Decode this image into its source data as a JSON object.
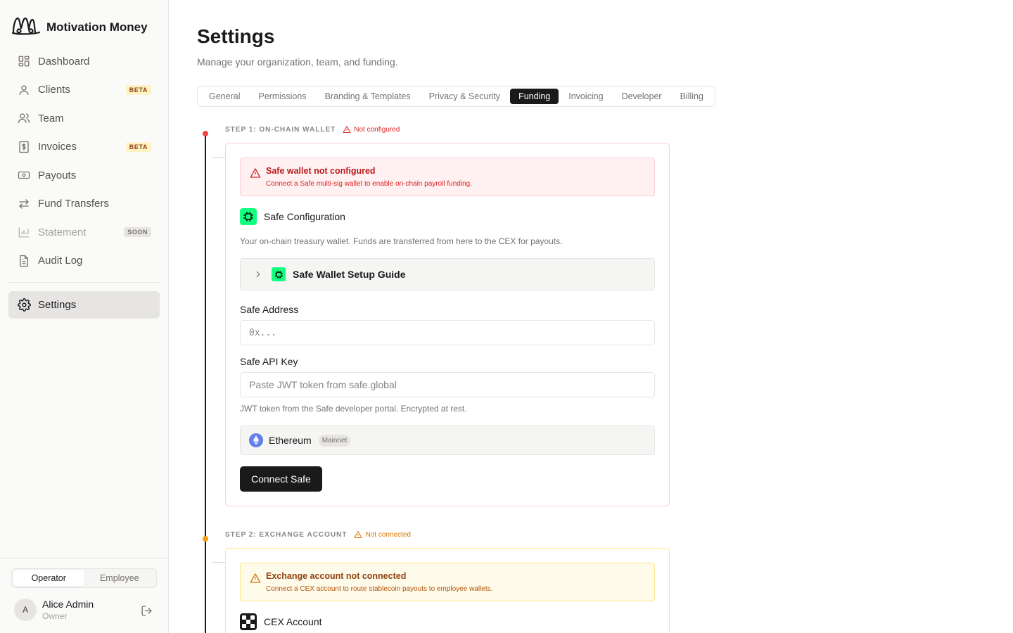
{
  "app": {
    "name": "Motivation Money"
  },
  "sidebar": {
    "items": [
      {
        "label": "Dashboard",
        "icon": "dashboard-icon"
      },
      {
        "label": "Clients",
        "icon": "user-icon",
        "badge": "BETA"
      },
      {
        "label": "Team",
        "icon": "users-icon"
      },
      {
        "label": "Invoices",
        "icon": "invoice-icon",
        "badge": "BETA"
      },
      {
        "label": "Payouts",
        "icon": "banknote-icon"
      },
      {
        "label": "Fund Transfers",
        "icon": "arrows-icon"
      },
      {
        "label": "Statement",
        "icon": "chart-icon",
        "badge": "SOON",
        "disabled": true
      },
      {
        "label": "Audit Log",
        "icon": "file-icon"
      }
    ],
    "settings": {
      "label": "Settings",
      "icon": "gear-icon"
    },
    "role_toggle": {
      "operator": "Operator",
      "employee": "Employee",
      "selected": "Operator"
    },
    "user": {
      "initial": "A",
      "name": "Alice Admin",
      "role": "Owner"
    }
  },
  "header": {
    "title": "Settings",
    "subtitle": "Manage your organization, team, and funding."
  },
  "tabs": [
    {
      "label": "General"
    },
    {
      "label": "Permissions"
    },
    {
      "label": "Branding & Templates"
    },
    {
      "label": "Privacy & Security"
    },
    {
      "label": "Funding",
      "active": true
    },
    {
      "label": "Invoicing"
    },
    {
      "label": "Developer"
    },
    {
      "label": "Billing"
    }
  ],
  "step1": {
    "label": "STEP 1: ON-CHAIN WALLET",
    "status": "Not configured",
    "alert_title": "Safe wallet not configured",
    "alert_desc": "Connect a Safe multi-sig wallet to enable on-chain payroll funding.",
    "section_title": "Safe Configuration",
    "description": "Your on-chain treasury wallet. Funds are transferred from here to the CEX for payouts.",
    "guide_label": "Safe Wallet Setup Guide",
    "address_label": "Safe Address",
    "address_placeholder": "0x...",
    "api_key_label": "Safe API Key",
    "api_key_placeholder": "Paste JWT token from safe.global",
    "api_key_hint": "JWT token from the Safe developer portal. Encrypted at rest.",
    "network_name": "Ethereum",
    "network_badge": "Mainnet",
    "connect_button": "Connect Safe"
  },
  "step2": {
    "label": "STEP 2: EXCHANGE ACCOUNT",
    "status": "Not connected",
    "alert_title": "Exchange account not connected",
    "alert_desc": "Connect a CEX account to route stablecoin payouts to employee wallets.",
    "section_title": "CEX Account"
  },
  "colors": {
    "accent": "#1a1a1a",
    "error": "#dc2626",
    "warning": "#d97706",
    "safe_green": "#12ff80",
    "ethereum": "#627eea"
  }
}
